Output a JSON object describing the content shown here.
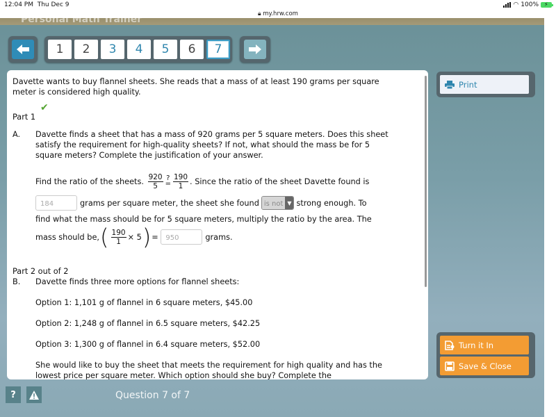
{
  "status_bar": {
    "time": "12:04 PM",
    "date": "Thu Dec 9",
    "battery": "100%",
    "url": "my.hrw.com"
  },
  "header": {
    "app_title": "Personal Math Trainer"
  },
  "navigation": {
    "prev_icon": "arrow-left-icon",
    "next_icon": "arrow-right-icon",
    "pages": [
      {
        "label": "1",
        "state": "unanswered"
      },
      {
        "label": "2",
        "state": "unanswered"
      },
      {
        "label": "3",
        "state": "answered"
      },
      {
        "label": "4",
        "state": "answered"
      },
      {
        "label": "5",
        "state": "answered"
      },
      {
        "label": "6",
        "state": "unanswered"
      },
      {
        "label": "7",
        "state": "current"
      }
    ]
  },
  "question": {
    "intro": "Davette wants to buy flannel sheets. She reads that a mass of at least 190 grams per square meter is considered high quality.",
    "part1": {
      "label": "Part 1",
      "status": "correct",
      "letter": "A.",
      "prompt": "Davette finds a sheet that has a mass of 920 grams per 5 square meters. Does this sheet satisfy the requirement for high-quality sheets? If not, what should the mass be for 5 square meters? Complete the justification of your answer.",
      "work": {
        "find_ratio": "Find the ratio of the sheets.",
        "frac1_num": "920",
        "frac1_den": "5",
        "compare_symbol": "?",
        "frac2_num": "190",
        "frac2_den": "1",
        "since_text": ". Since the ratio of the sheet Davette found is",
        "answer1_value": "184",
        "gpsm_text": "grams per square meter, the sheet she found",
        "dropdown_value": "is not",
        "strong_text": "strong enough. To",
        "find_line": "find what the mass should be for 5 square meters, multiply the ratio by the area. The",
        "mass_text": "mass should be,",
        "frac3_num": "190",
        "frac3_den": "1",
        "times_text": "× 5",
        "equals": "=",
        "answer2_value": "950",
        "grams_text": "grams."
      }
    },
    "part2": {
      "label": "Part 2 out of 2",
      "letter": "B.",
      "prompt": "Davette finds three more options for flannel sheets:",
      "options": [
        "Option 1: 1,101 g of flannel in 6 square meters, $45.00",
        "Option 2: 1,248 g of flannel in 6.5 square meters, $42.25",
        "Option 3: 1,300 g of flannel in 6.4 square meters, $52.00"
      ],
      "followup": "She would like to buy the sheet that meets the requirement for high quality and has the lowest price per square meter. Which option should she buy? Complete the"
    }
  },
  "sidebar": {
    "print_label": "Print",
    "turn_in_label": "Turn it In",
    "save_close_label": "Save & Close"
  },
  "footer": {
    "help_label": "?",
    "alert_label": "!",
    "question_counter": "Question 7 of 7"
  },
  "colors": {
    "accent_blue": "#2f86ae",
    "action_orange": "#f39c33",
    "correct_green": "#55a532"
  }
}
